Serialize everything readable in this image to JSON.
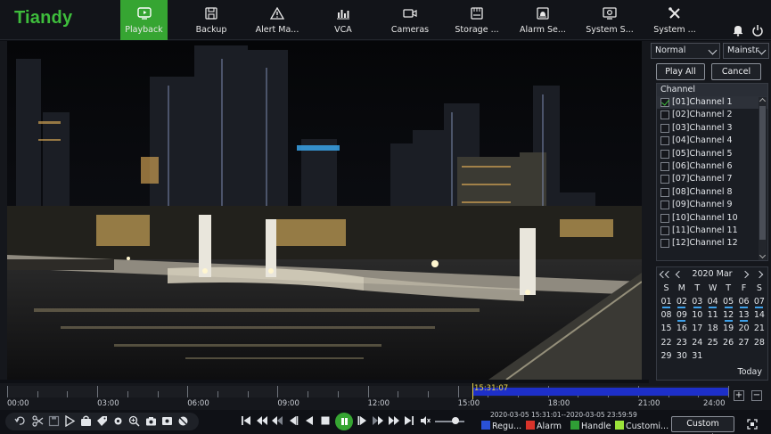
{
  "app": {
    "brand": "Tiandy"
  },
  "nav": [
    {
      "label": "Playback",
      "icon": "playback-icon",
      "active": true
    },
    {
      "label": "Backup",
      "icon": "backup-icon"
    },
    {
      "label": "Alert Ma...",
      "icon": "alert-icon"
    },
    {
      "label": "VCA",
      "icon": "vca-icon"
    },
    {
      "label": "Cameras",
      "icon": "camera-icon"
    },
    {
      "label": "Storage ...",
      "icon": "storage-icon"
    },
    {
      "label": "Alarm Se...",
      "icon": "alarm-icon"
    },
    {
      "label": "System S...",
      "icon": "system-icon"
    },
    {
      "label": "System ...",
      "icon": "tools-icon"
    }
  ],
  "panel": {
    "mode_select": "Normal",
    "stream_select": "Mainstr",
    "play_all": "Play All",
    "cancel": "Cancel",
    "channel_header": "Channel",
    "channels": [
      {
        "label": "[01]Channel 1",
        "checked": true
      },
      {
        "label": "[02]Channel 2",
        "checked": false
      },
      {
        "label": "[03]Channel 3",
        "checked": false
      },
      {
        "label": "[04]Channel 4",
        "checked": false
      },
      {
        "label": "[05]Channel 5",
        "checked": false
      },
      {
        "label": "[06]Channel 6",
        "checked": false
      },
      {
        "label": "[07]Channel 7",
        "checked": false
      },
      {
        "label": "[08]Channel 8",
        "checked": false
      },
      {
        "label": "[09]Channel 9",
        "checked": false
      },
      {
        "label": "[10]Channel 10",
        "checked": false
      },
      {
        "label": "[11]Channel 11",
        "checked": false
      },
      {
        "label": "[12]Channel 12",
        "checked": false
      }
    ]
  },
  "calendar": {
    "title": "2020 Mar",
    "weekdays": [
      "S",
      "M",
      "T",
      "W",
      "T",
      "F",
      "S"
    ],
    "days": [
      "01",
      "02",
      "03",
      "04",
      "05",
      "06",
      "07",
      "08",
      "09",
      "10",
      "11",
      "12",
      "13",
      "14",
      "15",
      "16",
      "17",
      "18",
      "19",
      "20",
      "21",
      "22",
      "23",
      "24",
      "25",
      "26",
      "27",
      "28",
      "29",
      "30",
      "31"
    ],
    "recorded_days": [
      "01",
      "02",
      "03",
      "04",
      "05",
      "06",
      "07",
      "09",
      "12",
      "13"
    ],
    "today_label": "Today"
  },
  "timeline": {
    "cursor_time": "15:31:07",
    "labels": [
      "00:00",
      "03:00",
      "06:00",
      "09:00",
      "12:00",
      "15:00",
      "18:00",
      "21:00",
      "24:00"
    ],
    "record_color": "#1d2fc9"
  },
  "bottom": {
    "range": "2020-03-05 15:31:01--2020-03-05 23:59:59",
    "legend": [
      {
        "label": "Regu...",
        "color": "#2a52d8"
      },
      {
        "label": "Alarm",
        "color": "#d8332a"
      },
      {
        "label": "Handle",
        "color": "#2f9e35"
      },
      {
        "label": "Customi...",
        "color": "#9be23a"
      }
    ],
    "custom_search": "Custom search"
  }
}
